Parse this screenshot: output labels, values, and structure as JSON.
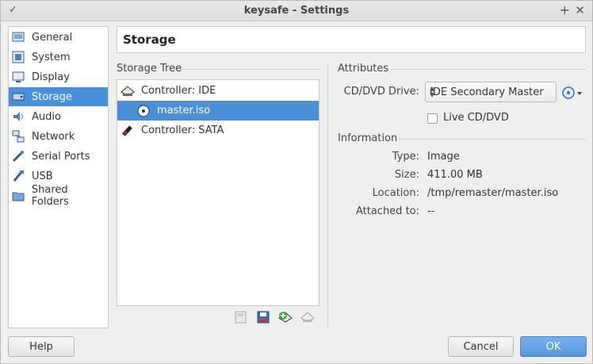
{
  "window": {
    "title": "keysafe - Settings"
  },
  "sidebar": {
    "items": [
      {
        "label": "General",
        "icon": "general-icon"
      },
      {
        "label": "System",
        "icon": "system-icon"
      },
      {
        "label": "Display",
        "icon": "display-icon"
      },
      {
        "label": "Storage",
        "icon": "storage-icon",
        "selected": true
      },
      {
        "label": "Audio",
        "icon": "audio-icon"
      },
      {
        "label": "Network",
        "icon": "network-icon"
      },
      {
        "label": "Serial Ports",
        "icon": "serial-ports-icon"
      },
      {
        "label": "USB",
        "icon": "usb-icon"
      },
      {
        "label": "Shared Folders",
        "icon": "shared-folders-icon"
      }
    ]
  },
  "page": {
    "title": "Storage"
  },
  "storage_tree": {
    "label": "Storage Tree",
    "rows": [
      {
        "label": "Controller: IDE",
        "icon": "ide-controller-icon"
      },
      {
        "label": "master.iso",
        "icon": "optical-disc-icon",
        "selected": true
      },
      {
        "label": "Controller: SATA",
        "icon": "sata-controller-icon"
      }
    ]
  },
  "attributes": {
    "label": "Attributes",
    "cd_dvd_drive_label": "CD/DVD Drive:",
    "cd_dvd_drive_value": "IDE Secondary Master",
    "live_cd_label": "Live CD/DVD",
    "live_cd_checked": false
  },
  "information": {
    "label": "Information",
    "rows": [
      {
        "label": "Type:",
        "value": "Image"
      },
      {
        "label": "Size:",
        "value": "411.00 MB"
      },
      {
        "label": "Location:",
        "value": "/tmp/remaster/master.iso"
      },
      {
        "label": "Attached to:",
        "value": "--"
      }
    ]
  },
  "buttons": {
    "help": "Help",
    "cancel": "Cancel",
    "ok": "OK"
  },
  "colors": {
    "selection": "#4a90d9",
    "ok_button": "#5796dc"
  }
}
